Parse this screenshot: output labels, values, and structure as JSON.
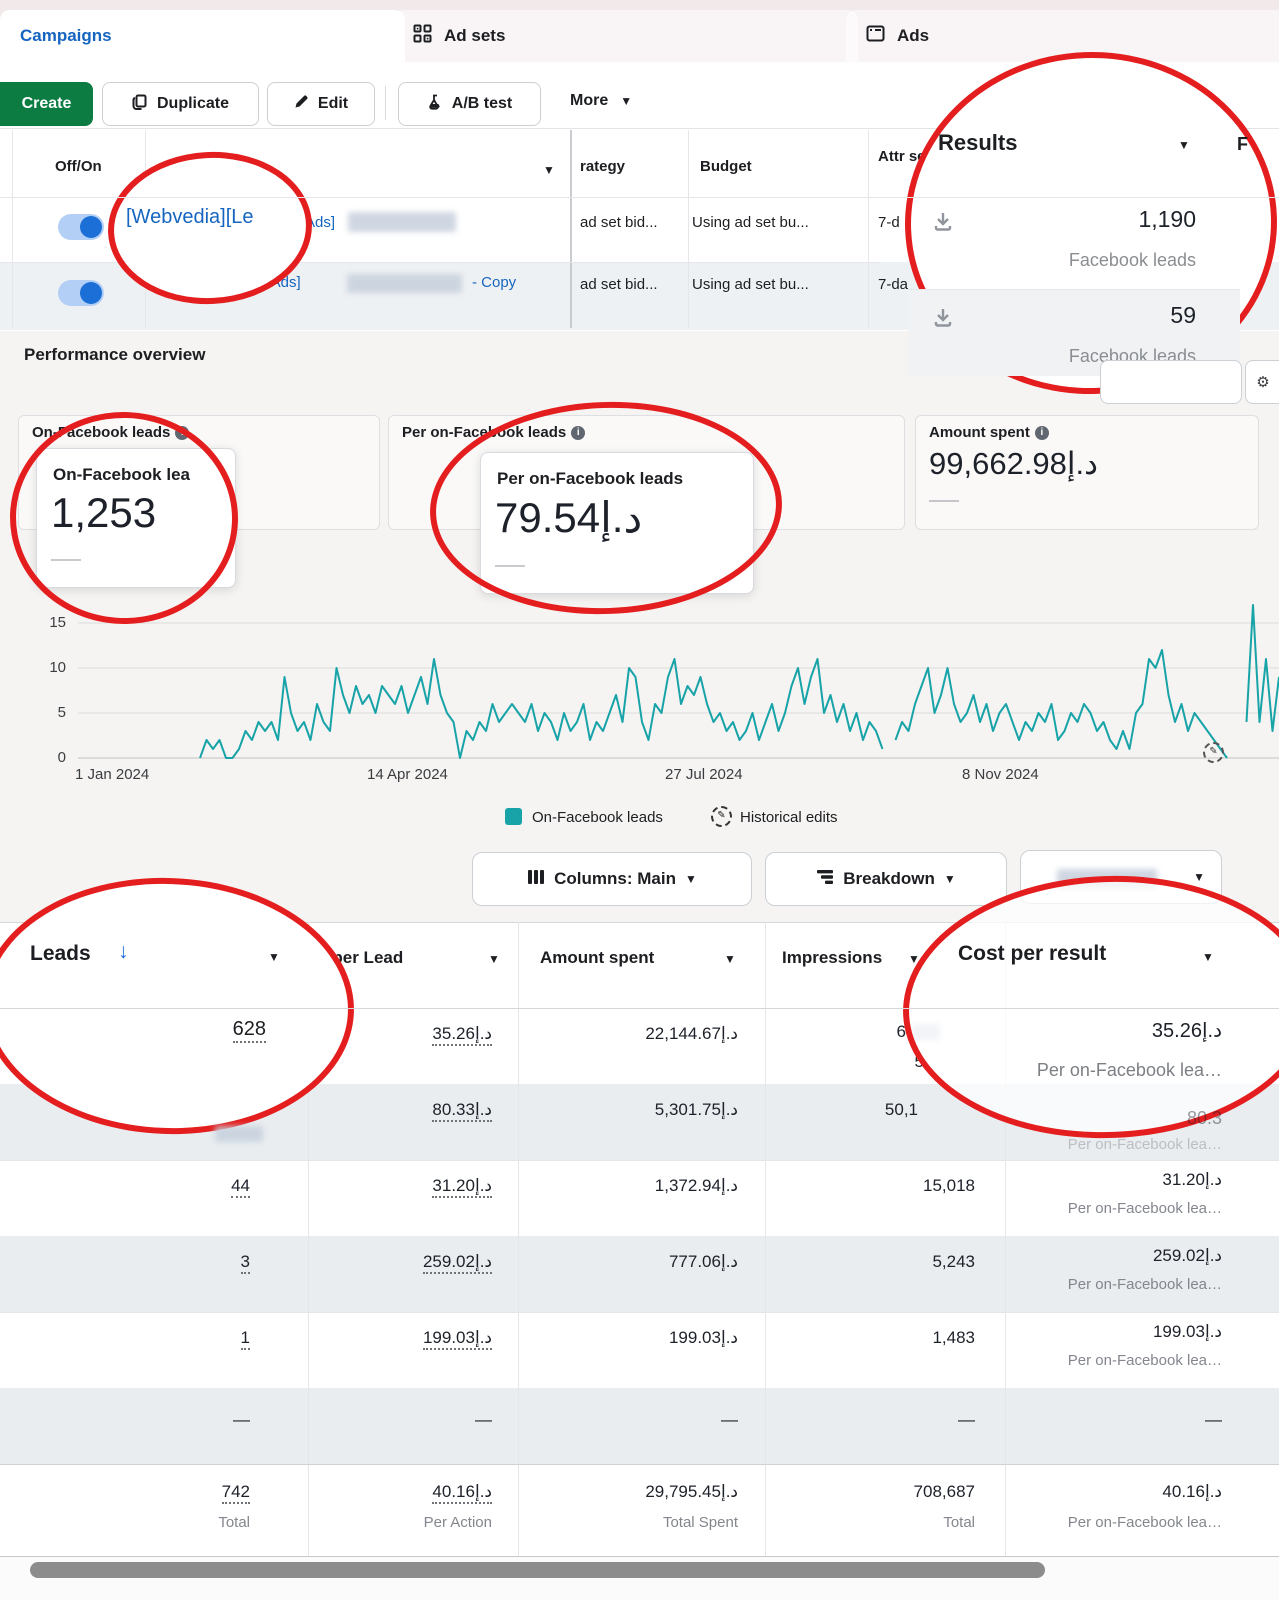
{
  "annotations": {
    "color": "#e41e1e",
    "regions": [
      "campaign-name",
      "results-column",
      "on-facebook-leads-metric",
      "per-on-facebook-leads-metric",
      "leads-column",
      "cost-per-result-column"
    ]
  },
  "tabs": {
    "campaigns": "Campaigns",
    "ad_sets": "Ad sets",
    "ads": "Ads"
  },
  "toolbar": {
    "create": "Create",
    "duplicate": "Duplicate",
    "edit": "Edit",
    "ab_test": "A/B test",
    "more": "More"
  },
  "campaign_table": {
    "off_on": "Off/On",
    "strategy_header": "rategy",
    "budget_header": "Budget",
    "attribution_header": "Attr set",
    "results_header": "Results",
    "next_column_partial": "F",
    "rows": [
      {
        "name_zoomed": "[Webvedia][Le",
        "name_visible": "Ads]",
        "strategy": "ad set bid...",
        "budget": "Using ad set bu...",
        "attribution": "7-d",
        "results": "1,190",
        "results_label": "Facebook leads"
      },
      {
        "name": "[Webvedia][Lead Ads]",
        "name_suffix": "- Copy",
        "strategy": "ad set bid...",
        "budget": "Using ad set bu...",
        "attribution": "7-da",
        "results": "59",
        "results_label": "Facebook leads"
      }
    ]
  },
  "performance": {
    "title": "Performance overview",
    "card1": {
      "label": "On-Facebook leads",
      "popup_title": "On-Facebook lea",
      "value": "1,253",
      "dash": "——"
    },
    "card2": {
      "label": "Per on-Facebook leads",
      "popup_title": "Per on-Facebook leads",
      "value": "79.54د.إ",
      "dash": "——"
    },
    "card3": {
      "label": "Amount spent",
      "value": "99,662.98د.إ",
      "dash": "——"
    },
    "legend": {
      "series": "On-Facebook leads",
      "edits": "Historical edits"
    }
  },
  "controls": {
    "columns": "Columns: Main",
    "breakdown": "Breakdown"
  },
  "chart_data": {
    "type": "line",
    "series_name": "On-Facebook leads",
    "color": "#17A3A8",
    "x_tick_labels": [
      "1 Jan 2024",
      "14 Apr 2024",
      "27 Jul 2024",
      "8 Nov 2024"
    ],
    "y_ticks": [
      0,
      5,
      10,
      15
    ],
    "ylim": [
      0,
      17
    ],
    "grid": true,
    "legend_position": "bottom",
    "note": "Daily on-Facebook leads estimated from pixels, Jan 2024 - Feb 2025; null = gap in line",
    "values": [
      0,
      2,
      1,
      2,
      0,
      0,
      1,
      3,
      2,
      4,
      3,
      4,
      2,
      9,
      5,
      3,
      4,
      2,
      6,
      4,
      3,
      10,
      7,
      5,
      8,
      6,
      7,
      5,
      8,
      7,
      6,
      8,
      5,
      7,
      9,
      6,
      11,
      7,
      5,
      4,
      0,
      3,
      2,
      4,
      3,
      6,
      4,
      5,
      6,
      5,
      4,
      6,
      3,
      5,
      4,
      2,
      5,
      3,
      4,
      6,
      2,
      4,
      3,
      5,
      7,
      4,
      10,
      9,
      4,
      2,
      6,
      5,
      9,
      11,
      6,
      8,
      7,
      9,
      6,
      4,
      5,
      3,
      4,
      2,
      3,
      5,
      2,
      4,
      6,
      3,
      5,
      8,
      10,
      6,
      9,
      11,
      5,
      7,
      4,
      6,
      3,
      5,
      2,
      4,
      3,
      1,
      null,
      2,
      4,
      3,
      6,
      8,
      10,
      5,
      7,
      10,
      6,
      4,
      5,
      7,
      4,
      6,
      3,
      5,
      6,
      4,
      2,
      4,
      3,
      5,
      4,
      6,
      2,
      3,
      5,
      4,
      6,
      5,
      3,
      4,
      2,
      1,
      3,
      1,
      5,
      6,
      11,
      10,
      12,
      7,
      4,
      6,
      3,
      5,
      4,
      3,
      2,
      1,
      0,
      null,
      null,
      4,
      17,
      4,
      11,
      3,
      9
    ]
  },
  "stats_table": {
    "leads_header": "Leads",
    "cost_per_lead_header": "t per Lead",
    "amount_spent_header": "Amount spent",
    "impressions_header": "Impressions",
    "cost_per_result_header": "Cost per result",
    "rows": [
      {
        "leads": "628",
        "cpl": "35.26د.إ",
        "spent": "22,144.67د.إ",
        "imp_a": "6",
        "imp_b": "5",
        "cpr": "35.26د.إ",
        "cpr_label": "Per on-Facebook lea…"
      },
      {
        "leads": "",
        "cpl": "80.33د.إ",
        "spent": "5,301.75د.إ",
        "imp": "50,1",
        "cpr": "80.3",
        "cpr_label": "Per on-Facebook lea…"
      },
      {
        "leads": "44",
        "cpl": "31.20د.إ",
        "spent": "1,372.94د.إ",
        "imp": "15,018",
        "cpr": "31.20د.إ",
        "cpr_label": "Per on-Facebook lea…"
      },
      {
        "leads": "3",
        "cpl": "259.02د.إ",
        "spent": "777.06د.إ",
        "imp": "5,243",
        "cpr": "259.02د.إ",
        "cpr_label": "Per on-Facebook lea…"
      },
      {
        "leads": "1",
        "cpl": "199.03د.إ",
        "spent": "199.03د.إ",
        "imp": "1,483",
        "cpr": "199.03د.إ",
        "cpr_label": "Per on-Facebook lea…"
      },
      {
        "leads": "—",
        "cpl": "—",
        "spent": "—",
        "imp": "—",
        "cpr": "—",
        "cpr_label": ""
      }
    ],
    "total": {
      "leads": "742",
      "leads_label": "Total",
      "cpl": "40.16د.إ",
      "cpl_label": "Per Action",
      "spent": "29,795.45د.إ",
      "spent_label": "Total Spent",
      "imp": "708,687",
      "imp_label": "Total",
      "cpr": "40.16د.إ",
      "cpr_label": "Per on-Facebook lea…"
    }
  }
}
